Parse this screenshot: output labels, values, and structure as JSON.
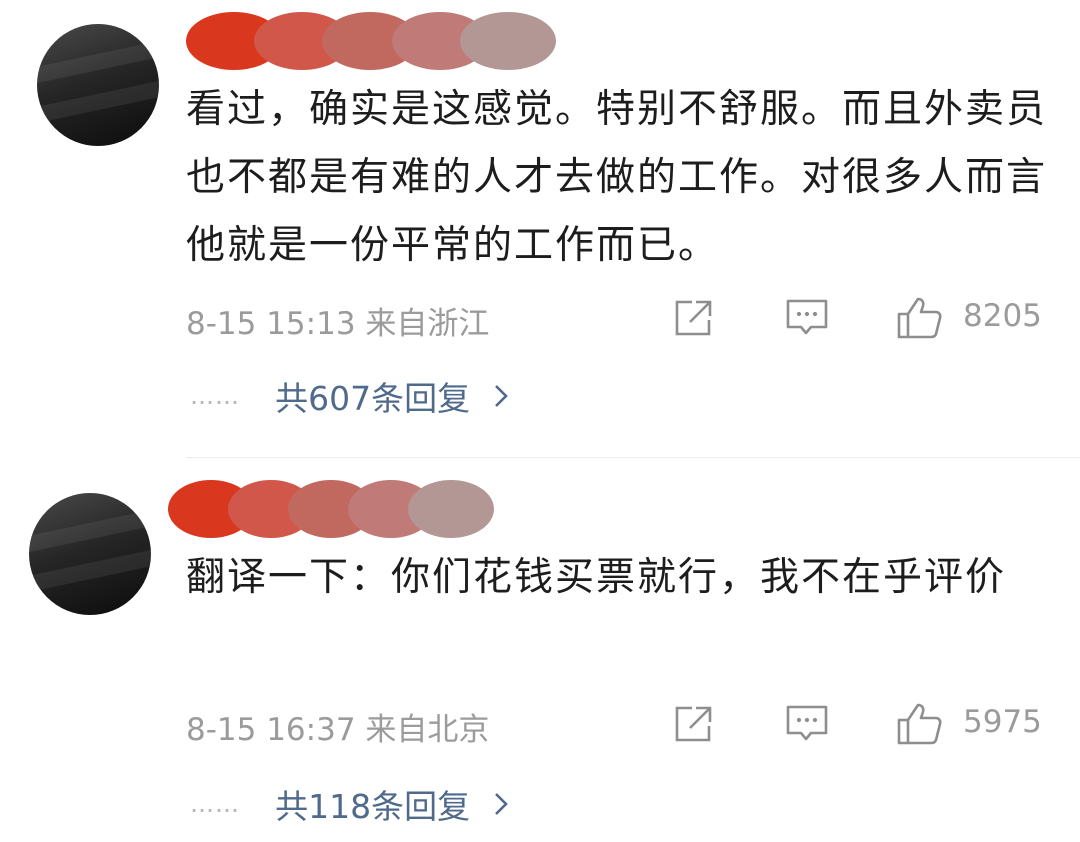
{
  "comments": [
    {
      "text": "看过，确实是这感觉。特别不舒服。而且外卖员也不都是有难的人才去做的工作。对很多人而言他就是一份平常的工作而已。",
      "meta": "8-15 15:13  来自浙江",
      "likes": "8205",
      "reply_label": "共607条回复",
      "dots": "……",
      "icons": [
        "avatar-photo",
        "share-icon",
        "comment-icon",
        "thumbs-up-icon",
        "chevron-right-icon"
      ]
    },
    {
      "text": "翻译一下：你们花钱买票就行，我不在乎评价",
      "meta": "8-15 16:37  来自北京",
      "likes": "5975",
      "reply_label": "共118条回复",
      "dots": "……",
      "icons": [
        "avatar-photo",
        "share-icon",
        "comment-icon",
        "thumbs-up-icon",
        "chevron-right-icon"
      ]
    }
  ],
  "colors": {
    "name_blobs": [
      "#d9371e",
      "#d0574a",
      "#c2695f",
      "#c07a78",
      "#b29794"
    ],
    "reply_link": "#506a8c",
    "meta_text": "#9b9b9b"
  }
}
